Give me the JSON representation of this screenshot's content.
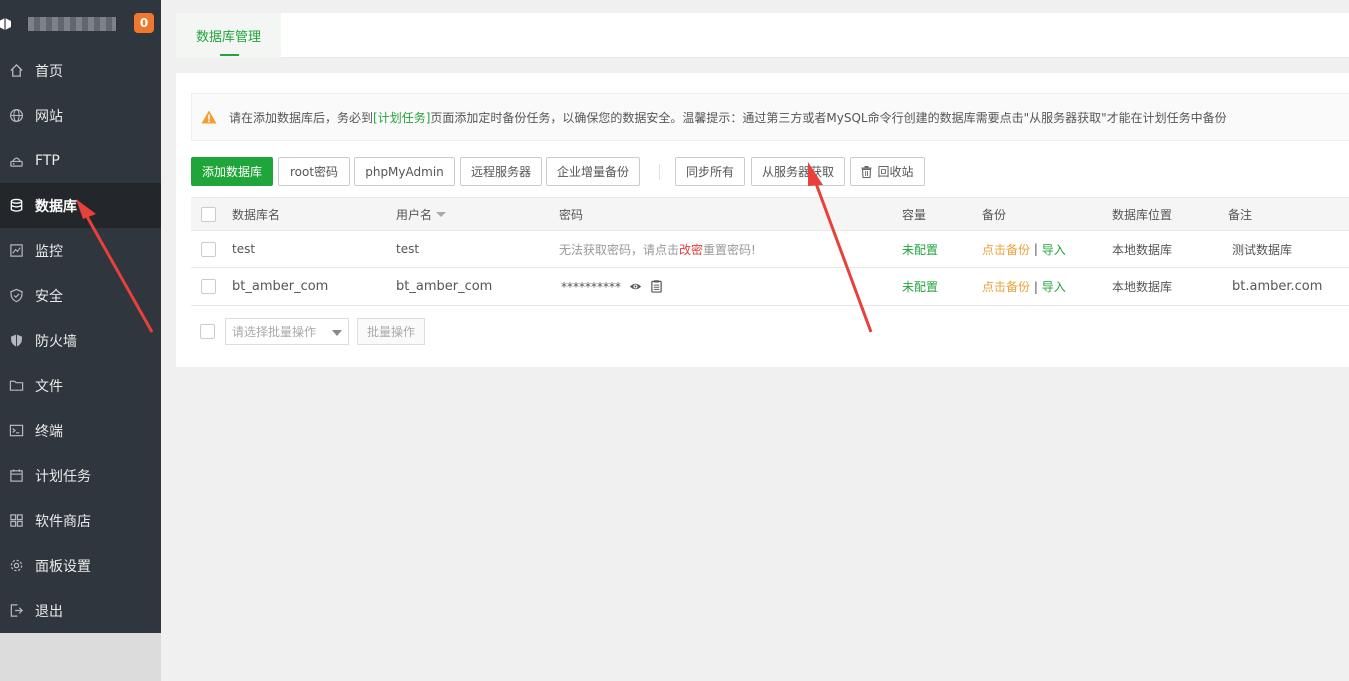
{
  "sidebar": {
    "badge": "0",
    "items": [
      {
        "label": "首页",
        "icon": "home-icon"
      },
      {
        "label": "网站",
        "icon": "globe-icon"
      },
      {
        "label": "FTP",
        "icon": "ftp-icon"
      },
      {
        "label": "数据库",
        "icon": "database-icon",
        "active": true
      },
      {
        "label": "监控",
        "icon": "monitor-icon"
      },
      {
        "label": "安全",
        "icon": "shield-icon"
      },
      {
        "label": "防火墙",
        "icon": "firewall-icon"
      },
      {
        "label": "文件",
        "icon": "folder-icon"
      },
      {
        "label": "终端",
        "icon": "terminal-icon"
      },
      {
        "label": "计划任务",
        "icon": "calendar-icon"
      },
      {
        "label": "软件商店",
        "icon": "apps-icon"
      },
      {
        "label": "面板设置",
        "icon": "gear-icon"
      },
      {
        "label": "退出",
        "icon": "logout-icon"
      }
    ]
  },
  "tab": {
    "label": "数据库管理"
  },
  "notice": {
    "prefix": "请在添加数据库后，务必到",
    "link": "[计划任务]",
    "suffix": "页面添加定时备份任务，以确保您的数据安全。温馨提示：通过第三方或者MySQL命令行创建的数据库需要点击\"从服务器获取\"才能在计划任务中备份"
  },
  "toolbar": {
    "add_db": "添加数据库",
    "root_pwd": "root密码",
    "phpmyadmin": "phpMyAdmin",
    "remote_server": "远程服务器",
    "incremental_backup": "企业增量备份",
    "sync_all": "同步所有",
    "fetch_from_server": "从服务器获取",
    "recycle_bin": "回收站"
  },
  "table": {
    "headers": {
      "name": "数据库名",
      "username": "用户名",
      "password": "密码",
      "capacity": "容量",
      "backup": "备份",
      "location": "数据库位置",
      "remark": "备注"
    },
    "rows": [
      {
        "name": "test",
        "username": "test",
        "pwd_prefix": "无法获取密码，请点击",
        "pwd_link": "改密",
        "pwd_suffix": "重置密码!",
        "capacity": "未配置",
        "backup": "点击备份",
        "sep": "|",
        "import": "导入",
        "location": "本地数据库",
        "remark": "测试数据库"
      },
      {
        "name": "bt_amber_com",
        "username": "bt_amber_com",
        "password_mask": "**********",
        "capacity": "未配置",
        "backup": "点击备份",
        "sep": "|",
        "import": "导入",
        "location": "本地数据库",
        "remark": "bt.amber.com"
      }
    ]
  },
  "batch": {
    "select_placeholder": "请选择批量操作",
    "button": "批量操作"
  },
  "colors": {
    "accent": "#20a53a",
    "sidebar_bg": "#30363d",
    "warning": "#f0782e",
    "annotation_arrow": "#e8403a"
  }
}
